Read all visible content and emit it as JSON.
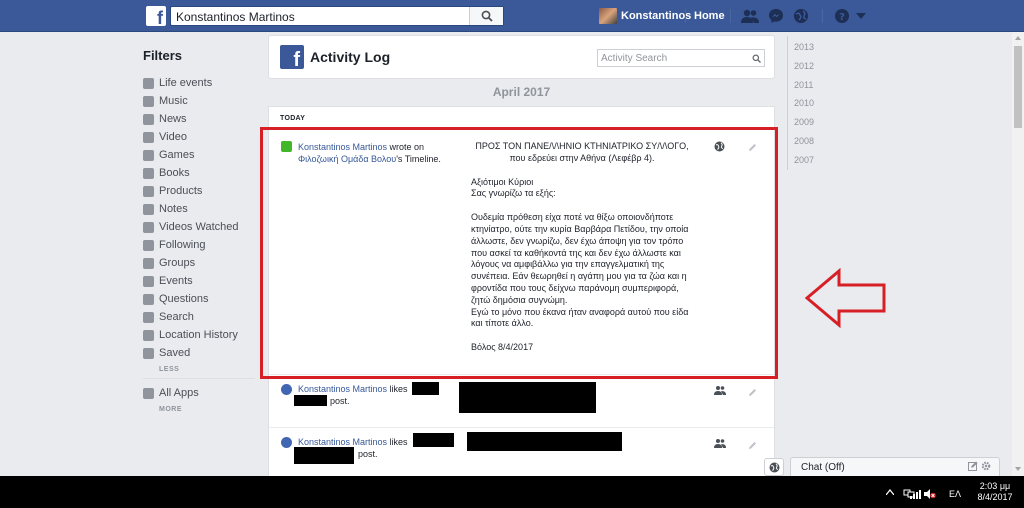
{
  "topbar": {
    "logo": "f",
    "search_value": "Konstantinos Martinos",
    "user_name": "Konstantinos",
    "home_label": "Home"
  },
  "sidebar": {
    "title": "Filters",
    "items": [
      {
        "label": "Life events",
        "icon": "flag-icon"
      },
      {
        "label": "Music",
        "icon": "music-icon"
      },
      {
        "label": "News",
        "icon": "news-icon"
      },
      {
        "label": "Video",
        "icon": "video-icon"
      },
      {
        "label": "Games",
        "icon": "games-icon"
      },
      {
        "label": "Books",
        "icon": "book-icon"
      },
      {
        "label": "Products",
        "icon": "bag-icon"
      },
      {
        "label": "Notes",
        "icon": "note-icon"
      },
      {
        "label": "Videos Watched",
        "icon": "video-icon"
      },
      {
        "label": "Following",
        "icon": "rss-icon"
      },
      {
        "label": "Groups",
        "icon": "groups-icon"
      },
      {
        "label": "Events",
        "icon": "calendar-icon"
      },
      {
        "label": "Questions",
        "icon": "question-icon"
      },
      {
        "label": "Search",
        "icon": "search-icon"
      },
      {
        "label": "Location History",
        "icon": "location-icon"
      },
      {
        "label": "Saved",
        "icon": "bookmark-icon"
      }
    ],
    "less_label": "LESS",
    "all_apps_label": "All Apps",
    "more_label": "MORE"
  },
  "activity_log": {
    "logo": "f",
    "title": "Activity Log",
    "search_placeholder": "Activity Search",
    "month": "April 2017",
    "today_label": "TODAY"
  },
  "entries": [
    {
      "actor": "Konstantinos Martinos",
      "verb": " wrote on",
      "target": "Φιλοζωική Ομάδα Βολου",
      "suffix": "'s Timeline.",
      "body": {
        "p1": "ΠΡΟΣ ΤΟΝ ΠΑΝΕ/\\/\\ΗΝΙΟ ΚΤΗΝΙΑΤΡΙΚΟ ΣΥ/\\/\\ΟΓΟ, που εδρεύει στην Αθήνα (Λεφέβρ 4).",
        "p2a": "Αξιότιμοι Κύριοι",
        "p2b": "Σας γνωρίζω τα εξής:",
        "p3": "Ουδεμία πρόθεση είχα ποτέ να θίξω οποιονδήποτε κτηνίατρο, ούτε την κυρία Βαρβάρα Πετίδου, την οποία άλλωστε, δεν γνωρίζω, δεν έχω άποψη για τον τρόπο που ασκεί τα καθήκοντά της και δεν έχω άλλωστε και λόγους να αμφιβάλλω για την επαγγελματική της συνέπεια. Εάν θεωρηθεί η αγάπη μου για τα ζώα και η φροντίδα που τους δείχνω παράνομη συμπεριφορά, ζητώ δημόσια συγνώμη.",
        "p4": "Εγώ το μόνο που έκανα ήταν αναφορά αυτού που είδα και τίποτε άλλο.",
        "p5": "Βόλος 8/4/2017"
      }
    },
    {
      "actor": "Konstantinos Martinos",
      "verb": " likes",
      "suffix": "post."
    },
    {
      "actor": "Konstantinos Martinos",
      "verb": " likes",
      "suffix": "post."
    }
  ],
  "years": [
    "2013",
    "2012",
    "2011",
    "2010",
    "2009",
    "2008",
    "2007"
  ],
  "chat": {
    "label": "Chat (Off)"
  },
  "taskbar": {
    "lang": "ΕΛ",
    "time": "2:03 μμ",
    "date": "8/4/2017"
  },
  "colors": {
    "brand": "#3b5998",
    "link": "#365899",
    "highlight": "#d71f26"
  }
}
